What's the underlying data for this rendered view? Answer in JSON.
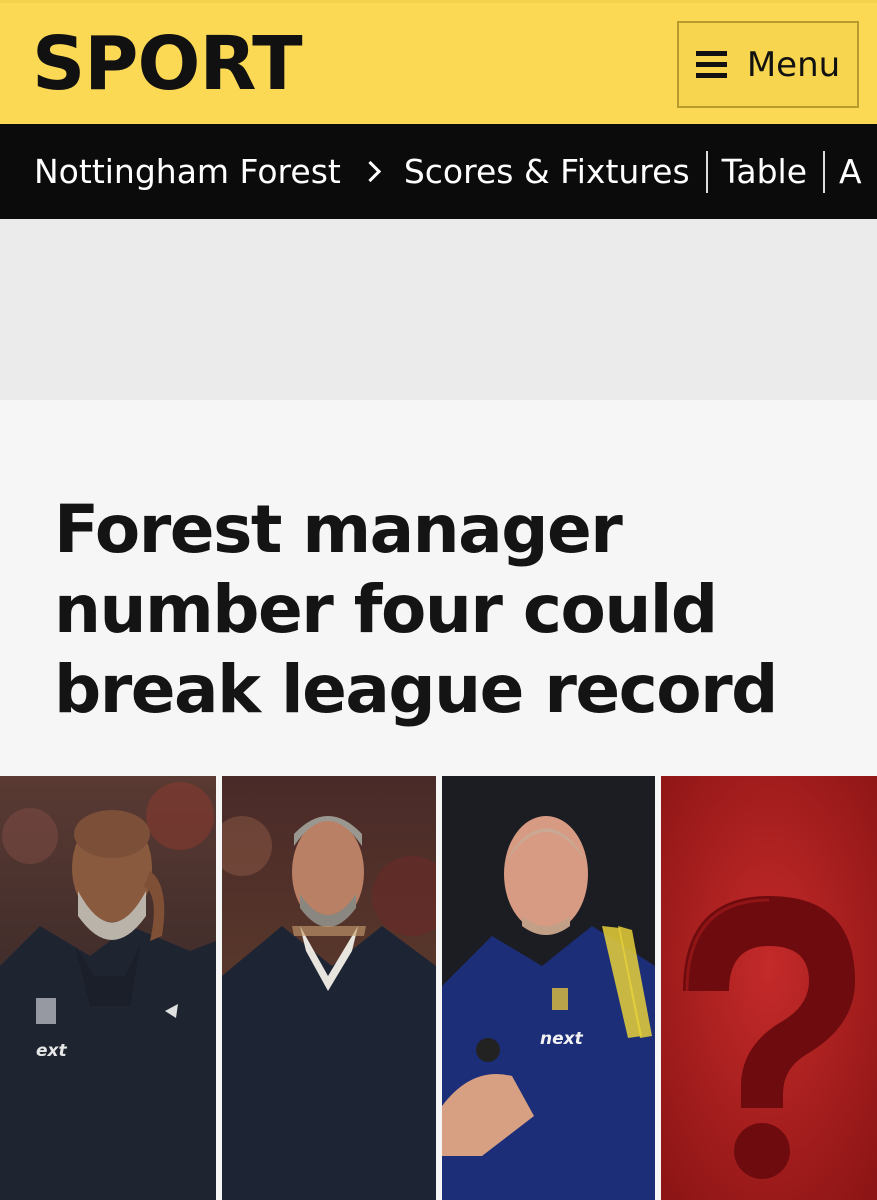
{
  "header": {
    "brand": "SPORT",
    "menu_label": "Menu",
    "colors": {
      "background": "#fcd955",
      "text": "#111111"
    }
  },
  "subnav": {
    "items": [
      {
        "label": "Nottingham Forest"
      },
      {
        "label": "Scores & Fixtures"
      },
      {
        "label": "Table"
      },
      {
        "label": "A"
      }
    ]
  },
  "article": {
    "headline": "Forest manager number four could break league record",
    "hero_image": {
      "panels": [
        {
          "icon": "manager-photo-icon",
          "kit_text": "ext"
        },
        {
          "icon": "manager-photo-icon"
        },
        {
          "icon": "manager-photo-icon",
          "kit_text": "next"
        },
        {
          "icon": "question-mark-icon"
        }
      ]
    }
  }
}
